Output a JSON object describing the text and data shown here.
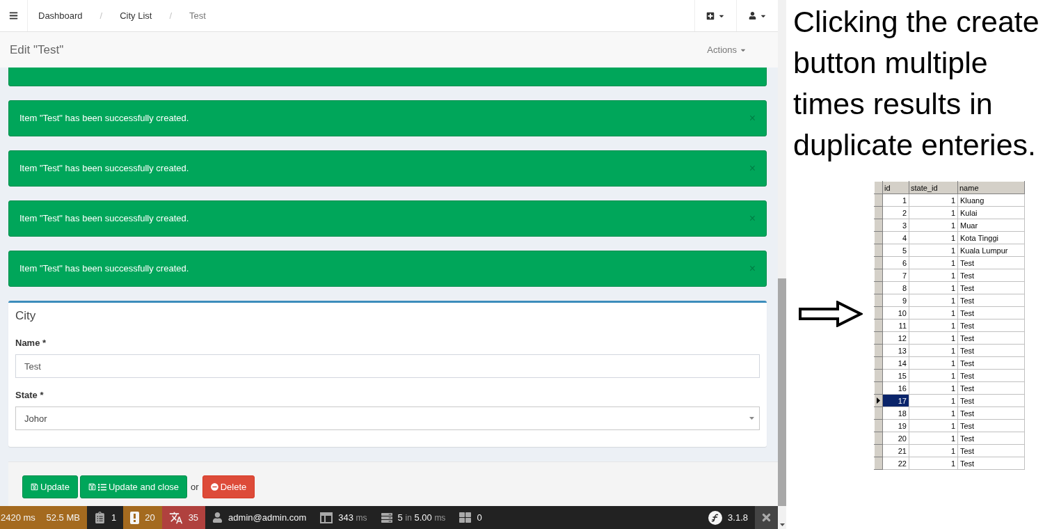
{
  "navbar": {
    "breadcrumbs": [
      {
        "label": "Dashboard",
        "current": false
      },
      {
        "divider": "/",
        "label": "City List",
        "current": false
      },
      {
        "divider": "/",
        "label": "Test",
        "current": true
      }
    ]
  },
  "page_header": {
    "title": "Edit \"Test\"",
    "actions": "Actions"
  },
  "alerts": [
    {
      "kind": "partial"
    },
    {
      "kind": "full",
      "message": "Item \"Test\" has been successfully created.",
      "dismiss": "×"
    },
    {
      "kind": "full",
      "message": "Item \"Test\" has been successfully created.",
      "dismiss": "×"
    },
    {
      "kind": "full",
      "message": "Item \"Test\" has been successfully created.",
      "dismiss": "×"
    },
    {
      "kind": "full",
      "message": "Item \"Test\" has been successfully created.",
      "dismiss": "×"
    }
  ],
  "box": {
    "title": "City",
    "fields": [
      {
        "kind": "text",
        "label": "Name *",
        "value": "Test"
      },
      {
        "kind": "select",
        "label": "State *",
        "value": "Johor"
      }
    ]
  },
  "form_actions": [
    {
      "kind": "update",
      "label": "Update"
    },
    {
      "kind": "update-close",
      "label": "Update and close"
    },
    {
      "kind": "text",
      "label": "or"
    },
    {
      "kind": "delete",
      "label": "Delete"
    }
  ],
  "debug_toolbar": {
    "items": [
      {
        "kind": "time-memory",
        "color": "#a46a1f",
        "texts": [
          {
            "text": "2420 ms",
            "muted": false
          },
          {
            "text": "52.5 MB",
            "muted": false
          }
        ]
      },
      {
        "kind": "request",
        "texts": [
          {
            "text": "1",
            "muted": false
          }
        ]
      },
      {
        "kind": "logs",
        "color": "#a46a1f",
        "texts": [
          {
            "text": "20",
            "muted": false
          }
        ]
      },
      {
        "kind": "translation",
        "color": "#b0413e",
        "texts": [
          {
            "text": "35",
            "muted": false
          }
        ]
      },
      {
        "kind": "user",
        "texts": [
          {
            "text": "admin@admin.com",
            "muted": false
          }
        ]
      },
      {
        "kind": "layout",
        "texts": [
          {
            "text": "343",
            "muted": false
          },
          {
            "text": "ms",
            "muted": true
          }
        ]
      },
      {
        "kind": "database",
        "texts": [
          {
            "text": "5",
            "muted": false
          },
          {
            "text": "in",
            "muted": true
          },
          {
            "text": "5.00",
            "muted": false
          },
          {
            "text": "ms",
            "muted": true
          }
        ]
      },
      {
        "kind": "grid",
        "texts": [
          {
            "text": "0",
            "muted": false
          }
        ]
      }
    ],
    "version": "3.1.8"
  },
  "annotation": {
    "text": "Clicking the create button multiple times results in duplicate enteries."
  },
  "db_table": {
    "columns": [
      "id",
      "state_id",
      "name"
    ],
    "rows": [
      {
        "cells": [
          "1",
          "1",
          "Kluang"
        ],
        "selected": false
      },
      {
        "cells": [
          "2",
          "1",
          "Kulai"
        ],
        "selected": false
      },
      {
        "cells": [
          "3",
          "1",
          "Muar"
        ],
        "selected": false
      },
      {
        "cells": [
          "4",
          "1",
          "Kota Tinggi"
        ],
        "selected": false
      },
      {
        "cells": [
          "5",
          "1",
          "Kuala Lumpur"
        ],
        "selected": false
      },
      {
        "cells": [
          "6",
          "1",
          "Test"
        ],
        "selected": false
      },
      {
        "cells": [
          "7",
          "1",
          "Test"
        ],
        "selected": false
      },
      {
        "cells": [
          "8",
          "1",
          "Test"
        ],
        "selected": false
      },
      {
        "cells": [
          "9",
          "1",
          "Test"
        ],
        "selected": false
      },
      {
        "cells": [
          "10",
          "1",
          "Test"
        ],
        "selected": false
      },
      {
        "cells": [
          "11",
          "1",
          "Test"
        ],
        "selected": false
      },
      {
        "cells": [
          "12",
          "1",
          "Test"
        ],
        "selected": false
      },
      {
        "cells": [
          "13",
          "1",
          "Test"
        ],
        "selected": false
      },
      {
        "cells": [
          "14",
          "1",
          "Test"
        ],
        "selected": false
      },
      {
        "cells": [
          "15",
          "1",
          "Test"
        ],
        "selected": false
      },
      {
        "cells": [
          "16",
          "1",
          "Test"
        ],
        "selected": false
      },
      {
        "cells": [
          "17",
          "1",
          "Test"
        ],
        "selected": true
      },
      {
        "cells": [
          "18",
          "1",
          "Test"
        ],
        "selected": false
      },
      {
        "cells": [
          "19",
          "1",
          "Test"
        ],
        "selected": false
      },
      {
        "cells": [
          "20",
          "1",
          "Test"
        ],
        "selected": false
      },
      {
        "cells": [
          "21",
          "1",
          "Test"
        ],
        "selected": false
      },
      {
        "cells": [
          "22",
          "1",
          "Test"
        ],
        "selected": false
      }
    ]
  }
}
